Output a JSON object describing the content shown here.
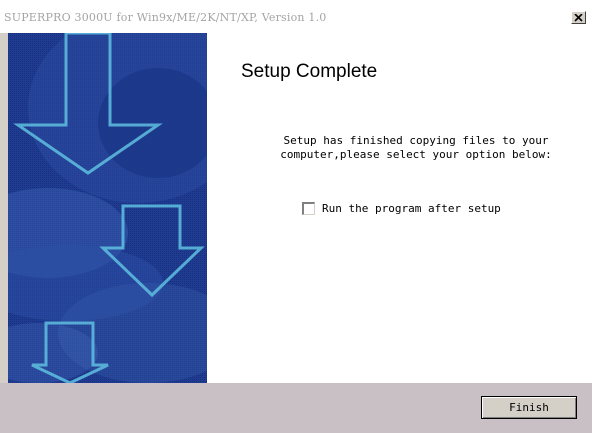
{
  "window": {
    "title": "SUPERPRO 3000U for Win9x/ME/2K/NT/XP, Version 1.0",
    "close_icon": "close-icon"
  },
  "side_panel": {
    "graphic": "decorative-down-arrows",
    "background_color": "#1e3a8e"
  },
  "content": {
    "heading": "Setup Complete",
    "message_lines": [
      "Setup has finished copying files to your",
      "computer,please select your option below:"
    ],
    "run_checkbox": {
      "label": "Run the program after setup",
      "checked": false
    }
  },
  "footer": {
    "finish_label": "Finish"
  },
  "colors": {
    "dialog_face": "#d4d0c8",
    "footer_face": "#c8c0c4",
    "title_text": "#a4a4a4"
  }
}
